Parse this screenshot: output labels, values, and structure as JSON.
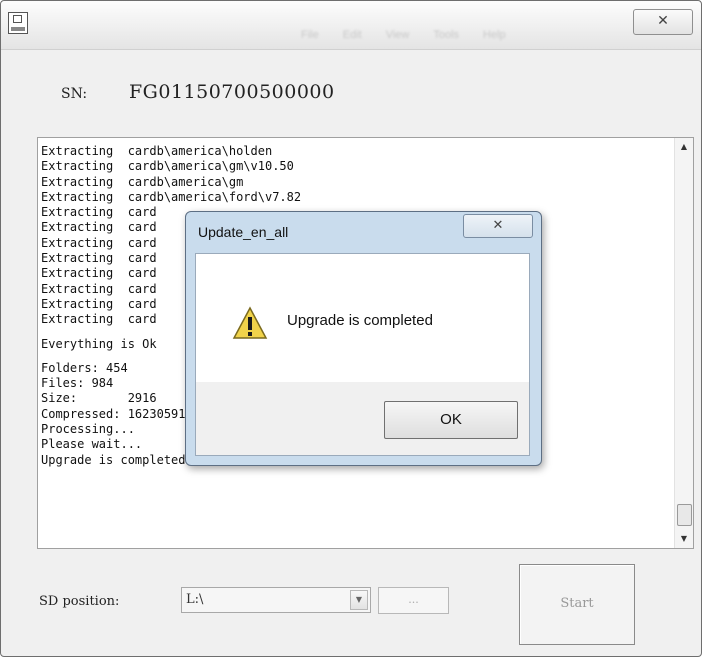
{
  "window": {
    "close_glyph": "✕",
    "menu_blurred": [
      "File",
      "Edit",
      "View",
      "Tools",
      "Help"
    ]
  },
  "sn": {
    "label": "SN:",
    "value": "FG01150700500000"
  },
  "log": {
    "lines": [
      "Extracting  cardb\\america\\holden",
      "Extracting  cardb\\america\\gm\\v10.50",
      "Extracting  cardb\\america\\gm",
      "Extracting  cardb\\america\\ford\\v7.82",
      "Extracting  card",
      "Extracting  card",
      "Extracting  card",
      "Extracting  card",
      "Extracting  card",
      "Extracting  card",
      "Extracting  card",
      "Extracting  card",
      "",
      "Everything is Ok",
      "",
      "Folders: 454",
      "Files: 984",
      "Size:       2916",
      "Compressed: 162305911",
      "Processing...",
      "Please wait...",
      "Upgrade is completed"
    ]
  },
  "controls": {
    "sd_label": "SD position:",
    "sd_value": "L:\\",
    "browse_label": "...",
    "start_label": "Start"
  },
  "dialog": {
    "title": "Update_en_all",
    "close_glyph": "✕",
    "message": "Upgrade is completed",
    "ok_label": "OK"
  },
  "colors": {
    "dialog_frame": "#c9dced",
    "warning_fill": "#f1d34a",
    "window_bg": "#f0f0f0"
  },
  "icons": {
    "app": "app-icon",
    "warning": "warning-icon",
    "scroll_up": "scroll-up-arrow-icon",
    "scroll_down": "scroll-down-arrow-icon",
    "dropdown": "chevron-down-icon"
  }
}
